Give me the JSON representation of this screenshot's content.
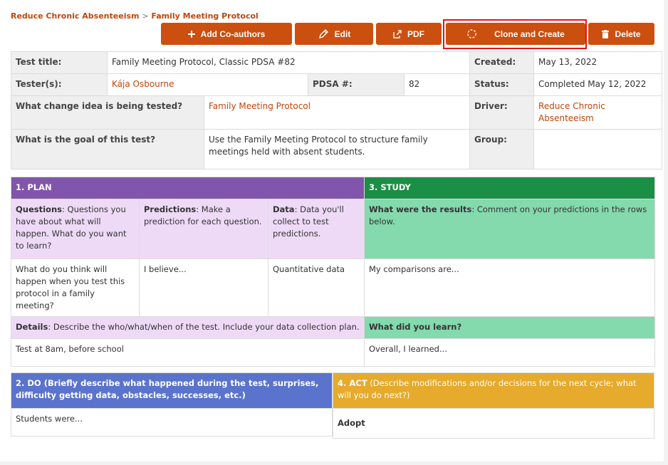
{
  "breadcrumb": {
    "parent": "Reduce Chronic Absenteeism",
    "separator": ">",
    "current": "Family Meeting Protocol"
  },
  "toolbar": {
    "add_coauthors": "Add Co-authors",
    "edit": "Edit",
    "pdf": "PDF",
    "clone": "Clone and Create",
    "delete": "Delete",
    "button_color": "#cb4f0f",
    "highlight_color": "#e8141b"
  },
  "info": {
    "test_title_label": "Test title:",
    "test_title": "Family Meeting Protocol, Classic PDSA #82",
    "created_label": "Created:",
    "created": "May 13, 2022",
    "testers_label": "Tester(s):",
    "testers": "Kája Osbourne",
    "pdsa_num_label": "PDSA #:",
    "pdsa_num": "82",
    "status_label": "Status:",
    "status": "Completed May 12, 2022",
    "change_idea_label": "What change idea is being tested?",
    "change_idea": "Family Meeting Protocol",
    "driver_label": "Driver:",
    "driver": "Reduce Chronic Absenteeism",
    "goal_label": "What is the goal of this test?",
    "goal": "Use the Family Meeting Protocol to structure family meetings held with absent students.",
    "group_label": "Group:",
    "group": ""
  },
  "plan": {
    "header": "1. PLAN",
    "questions_label": "Questions",
    "questions_desc": ": Questions you have about what will happen. What do you want to learn?",
    "predictions_label": "Predictions",
    "predictions_desc": ": Make a prediction for each question.",
    "data_label": "Data",
    "data_desc": ": Data you'll collect to test predictions.",
    "question_value": "What do you think will happen when you test this protocol in a family meeting?",
    "prediction_value": "I believe...",
    "data_value": "Quantitative data",
    "details_label": "Details",
    "details_desc": ": Describe the who/what/when of the test. Include your data collection plan.",
    "details_value": "Test at 8am, before school",
    "color": "#8155ab"
  },
  "study": {
    "header": "3. STUDY",
    "results_label": "What were the results",
    "results_desc": ": Comment on your predictions in the rows below.",
    "results_value": "My comparisons are...",
    "learn_label": "What did you learn?",
    "learn_value": "Overall, I learned...",
    "color": "#1a8f45"
  },
  "do": {
    "header_label": "2. DO",
    "header_desc": " (Briefly describe what happened during the test, surprises, difficulty getting data, obstacles, successes, etc.)",
    "value": "Students were...",
    "color": "#5a73cc"
  },
  "act": {
    "header_label": "4. ACT",
    "header_desc": " (Describe modifications and/or decisions for the next cycle; what will you do next?)",
    "value": "Adopt",
    "color": "#e6aa2c"
  }
}
